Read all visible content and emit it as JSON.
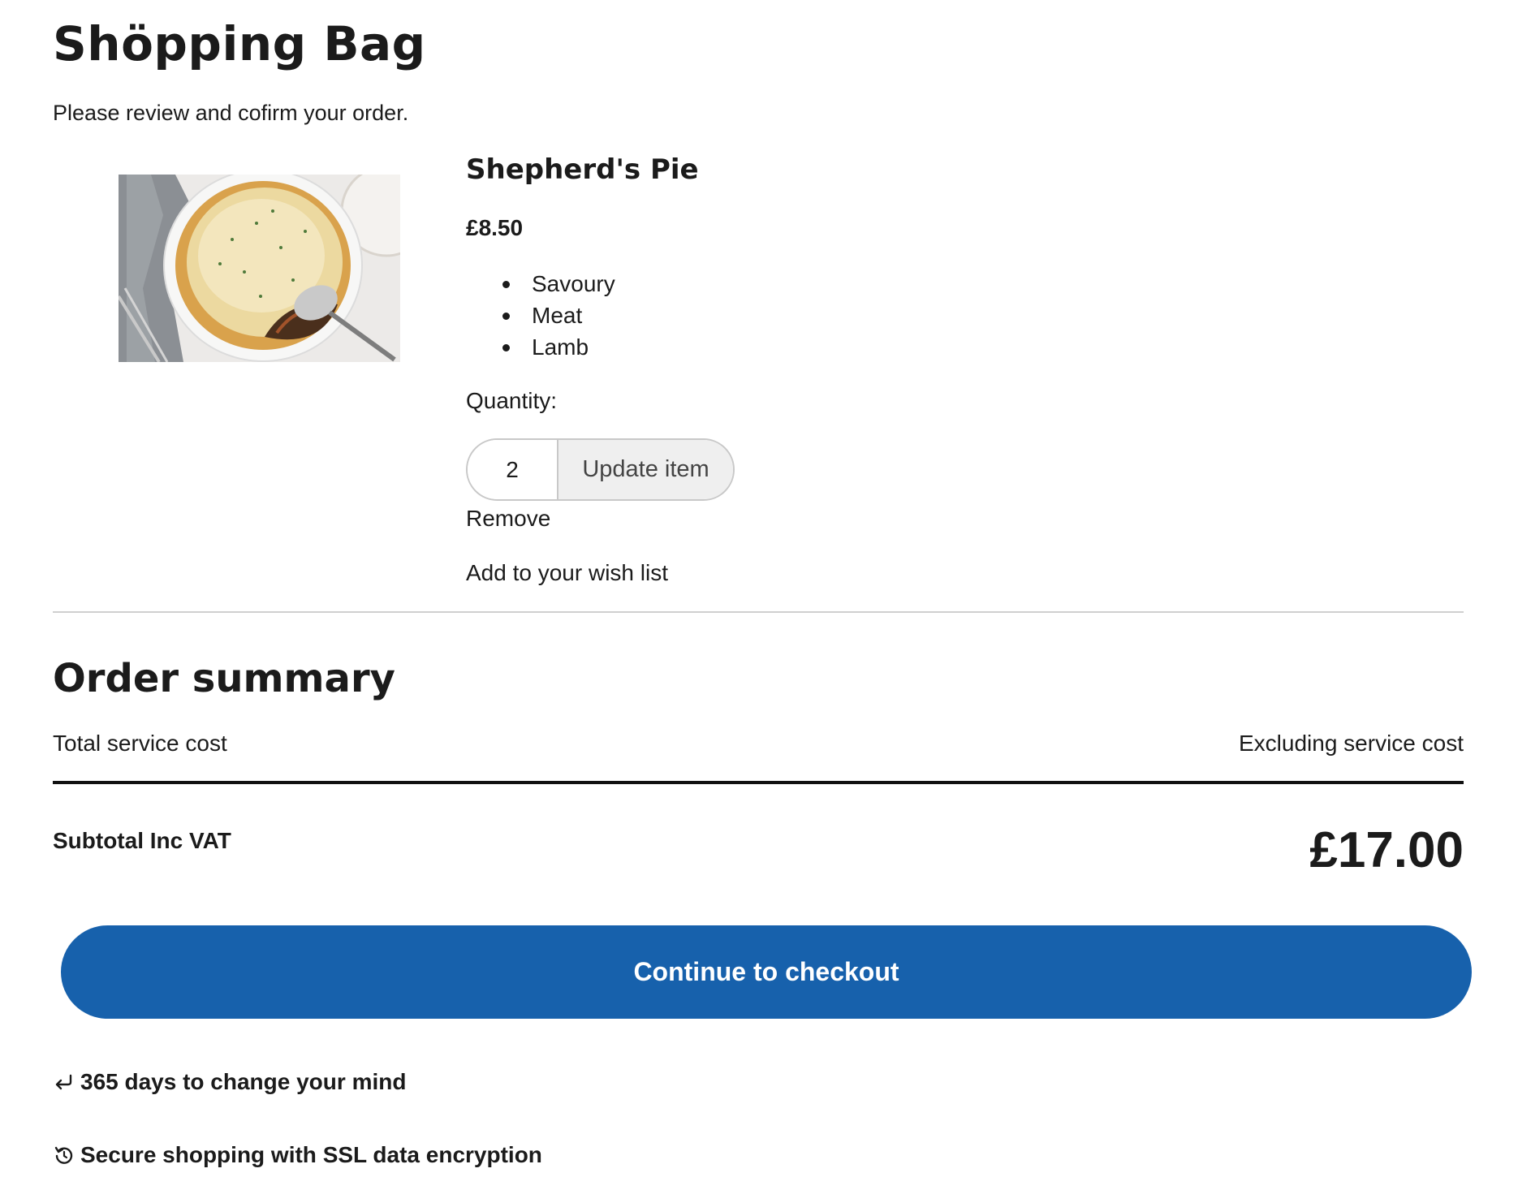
{
  "header": {
    "title": "Shöpping Bag",
    "subtitle": "Please review and cofirm your order."
  },
  "product": {
    "image_icon": "shepherds-pie-photo",
    "name": "Shepherd's Pie",
    "price": "£8.50",
    "tags": [
      "Savoury",
      "Meat",
      "Lamb"
    ],
    "quantity_label": "Quantity:",
    "quantity_value": "2",
    "update_label": "Update item",
    "remove_label": "Remove",
    "wishlist_label": "Add to your wish list"
  },
  "summary": {
    "title": "Order summary",
    "service_left": "Total service cost",
    "service_right": "Excluding service cost",
    "subtotal_label": "Subtotal Inc VAT",
    "subtotal_value": "£17.00"
  },
  "checkout": {
    "label": "Continue to checkout",
    "color": "#1761ac"
  },
  "assurances": [
    {
      "icon": "return-arrow-icon",
      "text": "365 days to change your mind"
    },
    {
      "icon": "refresh-lock-icon",
      "text": "Secure shopping with SSL data encryption"
    }
  ]
}
